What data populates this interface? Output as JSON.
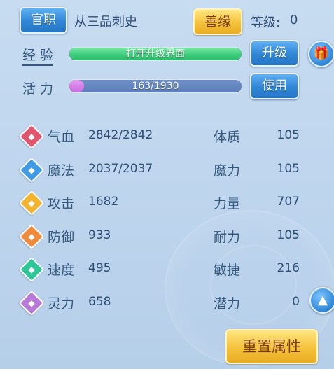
{
  "header": {
    "title_button": "官职",
    "rank": "从三品刺史",
    "karma_button": "善缘",
    "level_label": "等级:",
    "level_value": "0"
  },
  "exp": {
    "label": "经 验",
    "bar_text": "打开升级界面",
    "upgrade_button": "升级",
    "fill_fraction": 1.0
  },
  "vitality": {
    "label": "活 力",
    "bar_text": "163/1930",
    "use_button": "使用",
    "fill_fraction": 0.0845
  },
  "stats": [
    {
      "icon": "heart-icon",
      "color": "#e0566e",
      "name": "气血",
      "value": "2842/2842",
      "attr": "体质",
      "attr_value": "105"
    },
    {
      "icon": "mana-icon",
      "color": "#3f9be6",
      "name": "魔法",
      "value": "2037/2037",
      "attr": "魔力",
      "attr_value": "105"
    },
    {
      "icon": "attack-icon",
      "color": "#f2b32e",
      "name": "攻击",
      "value": "1682",
      "attr": "力量",
      "attr_value": "707"
    },
    {
      "icon": "defense-icon",
      "color": "#f08a3c",
      "name": "防御",
      "value": "933",
      "attr": "耐力",
      "attr_value": "105"
    },
    {
      "icon": "speed-icon",
      "color": "#2fc79a",
      "name": "速度",
      "value": "495",
      "attr": "敏捷",
      "attr_value": "216"
    },
    {
      "icon": "spirit-icon",
      "color": "#b87ad8",
      "name": "灵力",
      "value": "658",
      "attr": "潜力",
      "attr_value": "0"
    }
  ],
  "footer": {
    "reset_button": "重置属性"
  }
}
